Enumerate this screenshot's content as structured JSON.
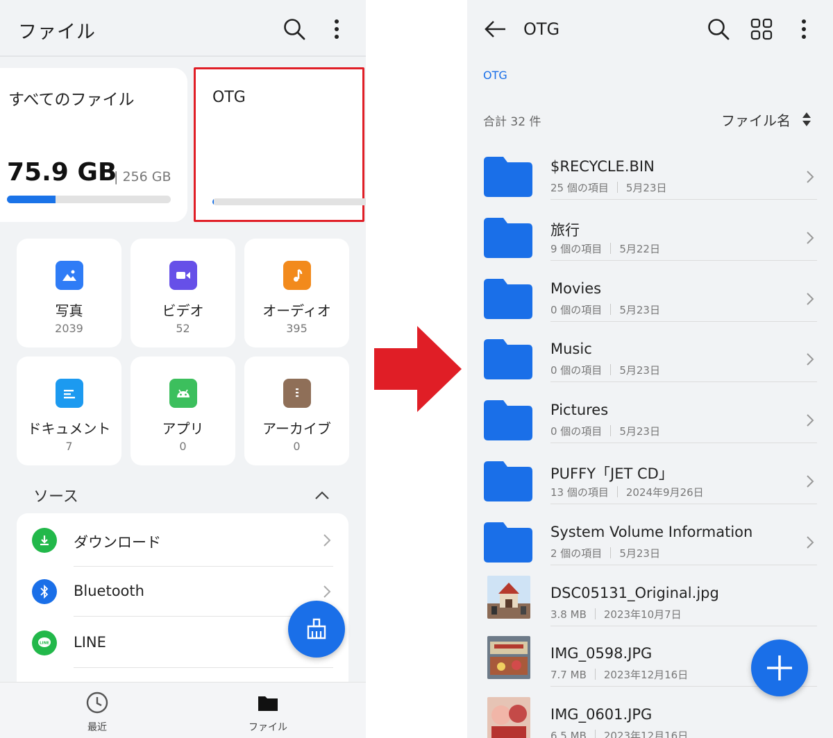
{
  "left": {
    "app_title": "ファイル",
    "storage": {
      "all_files_label": "すべてのファイル",
      "used": "75.9 GB",
      "total": "| 256 GB",
      "used_fraction": 0.296,
      "otg_label": "OTG",
      "otg_fraction": 0.01
    },
    "categories": [
      {
        "label": "写真",
        "count": "2039",
        "color": "#2f7cf6",
        "icon": "image-icon"
      },
      {
        "label": "ビデオ",
        "count": "52",
        "color": "#6650e8",
        "icon": "video-icon"
      },
      {
        "label": "オーディオ",
        "count": "395",
        "color": "#f28a1c",
        "icon": "music-note-icon"
      },
      {
        "label": "ドキュメント",
        "count": "7",
        "color": "#1c9af0",
        "icon": "document-icon"
      },
      {
        "label": "アプリ",
        "count": "0",
        "color": "#3cbf5d",
        "icon": "android-icon"
      },
      {
        "label": "アーカイブ",
        "count": "0",
        "color": "#8f6f58",
        "icon": "archive-icon"
      }
    ],
    "sources": {
      "heading": "ソース",
      "items": [
        {
          "label": "ダウンロード",
          "color": "#22b84a",
          "icon": "download-icon"
        },
        {
          "label": "Bluetooth",
          "color": "#1a6fe8",
          "icon": "bluetooth-icon"
        },
        {
          "label": "LINE",
          "color": "#22b84a",
          "icon": "line-app-icon"
        }
      ]
    },
    "nav": {
      "recent_label": "最近",
      "files_label": "ファイル"
    }
  },
  "right": {
    "title": "OTG",
    "breadcrumb": "OTG",
    "total": "合計 32 件",
    "sort_label": "ファイル名",
    "folder_color": "#1a6fe8",
    "files": [
      {
        "name": "$RECYCLE.BIN",
        "meta1": "25 個の項目",
        "meta2": "5月23日",
        "kind": "folder"
      },
      {
        "name": "旅行",
        "meta1": "9 個の項目",
        "meta2": "5月22日",
        "kind": "folder"
      },
      {
        "name": "Movies",
        "meta1": "0 個の項目",
        "meta2": "5月23日",
        "kind": "folder"
      },
      {
        "name": "Music",
        "meta1": "0 個の項目",
        "meta2": "5月23日",
        "kind": "folder"
      },
      {
        "name": "Pictures",
        "meta1": "0 個の項目",
        "meta2": "5月23日",
        "kind": "folder"
      },
      {
        "name": "PUFFY「JET CD」",
        "meta1": "13 個の項目",
        "meta2": "2024年9月26日",
        "kind": "folder"
      },
      {
        "name": "System Volume Information",
        "meta1": "2 個の項目",
        "meta2": "5月23日",
        "kind": "folder"
      },
      {
        "name": "DSC05131_Original.jpg",
        "meta1": "3.8 MB",
        "meta2": "2023年10月7日",
        "kind": "photo"
      },
      {
        "name": "IMG_0598.JPG",
        "meta1": "7.7 MB",
        "meta2": "2023年12月16日",
        "kind": "photo"
      },
      {
        "name": "IMG_0601.JPG",
        "meta1": "6.5 MB",
        "meta2": "2023年12月16日",
        "kind": "photo"
      }
    ]
  },
  "accent": "#1a6fe8",
  "highlight_color": "#e01e26"
}
